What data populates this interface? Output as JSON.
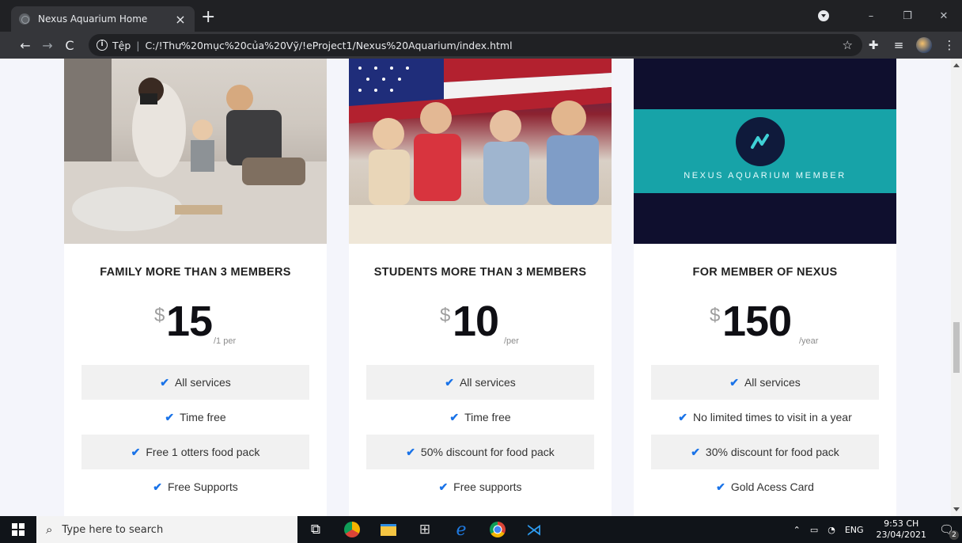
{
  "browser": {
    "tab_title": "Nexus Aquarium Home",
    "tab_close": "×",
    "new_tab": "+",
    "url_prefix": "Tệp",
    "url": "C:/!Thư%20mục%20của%20Vỹ/!eProject1/Nexus%20Aquarium/index.html",
    "window_controls": [
      "–",
      "❐",
      "✕"
    ]
  },
  "cards": [
    {
      "image": "family",
      "title": "FAMILY MORE THAN 3 MEMBERS",
      "currency": "$",
      "amount": "15",
      "period": "/1 per",
      "features": [
        "All services",
        "Time free",
        "Free 1 otters food pack",
        "Free Supports"
      ]
    },
    {
      "image": "students",
      "title": "STUDENTS MORE THAN 3 MEMBERS",
      "currency": "$",
      "amount": "10",
      "period": "/per",
      "features": [
        "All services",
        "Time free",
        "50% discount for food pack",
        "Free supports"
      ]
    },
    {
      "image": "member",
      "image_text": "NEXUS AQUARIUM MEMBER",
      "title": "FOR MEMBER OF NEXUS",
      "currency": "$",
      "amount": "150",
      "period": "/year",
      "features": [
        "All services",
        "No limited times to visit in a year",
        "30% discount for food pack",
        "Gold Acess Card"
      ]
    }
  ],
  "taskbar": {
    "search_placeholder": "Type here to search",
    "language": "ENG",
    "time": "9:53 CH",
    "date": "23/04/2021",
    "notification_count": "2"
  },
  "colors": {
    "check": "#1a73e8",
    "member_band": "#17a3a8",
    "member_bg": "#0f0f2e"
  }
}
